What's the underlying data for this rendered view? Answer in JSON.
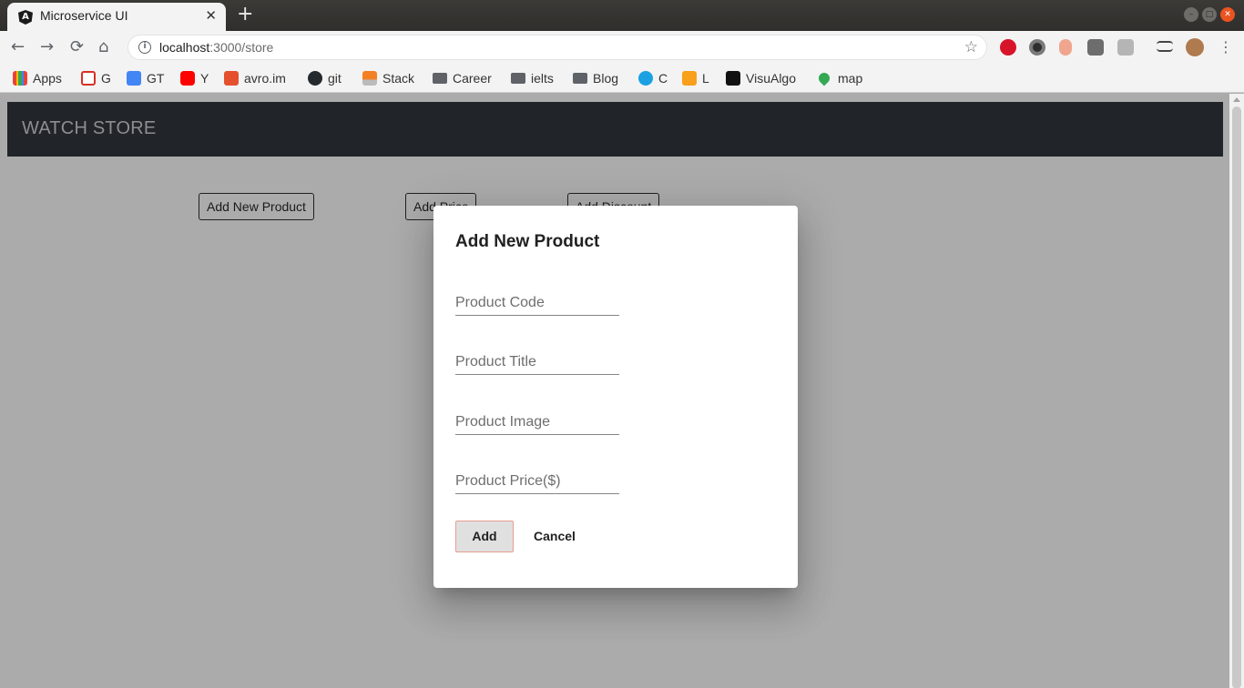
{
  "browser": {
    "tab_title": "Microservice UI",
    "tab_close": "✕",
    "new_tab": "+",
    "url_host": "localhost",
    "url_path": ":3000/store",
    "bookmarks": [
      {
        "label": "Apps",
        "icon": "apps-grid-icon",
        "color": "#e0453a"
      },
      {
        "label": "G",
        "icon": "gmail-icon",
        "color": "#d93025"
      },
      {
        "label": "GT",
        "icon": "google-translate-icon",
        "color": "#4285f4"
      },
      {
        "label": "Y",
        "icon": "youtube-icon",
        "color": "#ff0000"
      },
      {
        "label": "avro.im",
        "icon": "avro-icon",
        "color": "#e4502e"
      },
      {
        "label": "git",
        "icon": "github-icon",
        "color": "#24292e"
      },
      {
        "label": "Stack",
        "icon": "stackoverflow-icon",
        "color": "#f48024"
      },
      {
        "label": "Career",
        "icon": "folder-icon",
        "color": "#5f6368"
      },
      {
        "label": "ielts",
        "icon": "folder-icon",
        "color": "#5f6368"
      },
      {
        "label": "Blog",
        "icon": "folder-icon",
        "color": "#5f6368"
      },
      {
        "label": "C",
        "icon": "codeforces-icon",
        "color": "#1ba1e2"
      },
      {
        "label": "L",
        "icon": "leetcode-icon",
        "color": "#f89f1b"
      },
      {
        "label": "VisuAlgo",
        "icon": "visualgo-icon",
        "color": "#111111"
      },
      {
        "label": "map",
        "icon": "google-maps-icon",
        "color": "#34a853"
      }
    ]
  },
  "app": {
    "brand": "WATCH STORE",
    "buttons": {
      "add_product": "Add New Product",
      "add_price": "Add Price",
      "add_discount": "Add Discount"
    }
  },
  "dialog": {
    "title": "Add New Product",
    "fields": {
      "code_placeholder": "Product Code",
      "title_placeholder": "Product Title",
      "image_placeholder": "Product Image",
      "price_placeholder": "Product Price($)"
    },
    "add_label": "Add",
    "cancel_label": "Cancel"
  }
}
